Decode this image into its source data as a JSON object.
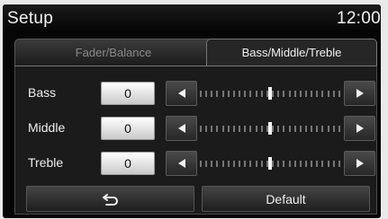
{
  "header": {
    "title": "Setup",
    "time": "12:00"
  },
  "tabs": [
    {
      "label": "Fader/Balance",
      "active": false
    },
    {
      "label": "Bass/Middle/Treble",
      "active": true
    }
  ],
  "rows": [
    {
      "label": "Bass",
      "value": "0",
      "level": 0.5
    },
    {
      "label": "Middle",
      "value": "0",
      "level": 0.5
    },
    {
      "label": "Treble",
      "value": "0",
      "level": 0.5
    }
  ],
  "icons": {
    "decrease": "left-triangle-icon",
    "increase": "right-triangle-icon",
    "back": "back-arrow-icon"
  },
  "buttons": {
    "default_label": "Default"
  },
  "colors": {
    "background": "#060606",
    "value_box": "#ffffff",
    "text": "#f0f0f0"
  }
}
